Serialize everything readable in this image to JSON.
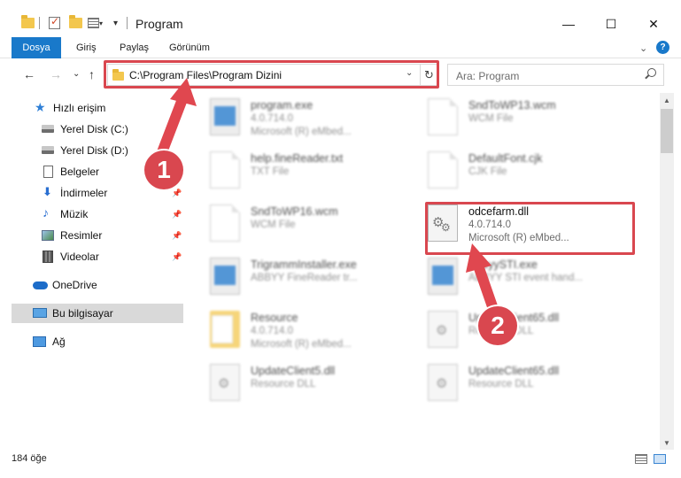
{
  "window": {
    "title": "Program",
    "minimize": "—",
    "maximize": "☐",
    "close": "✕"
  },
  "ribbon": {
    "file_tab": "Dosya",
    "tabs": [
      "Giriş",
      "Paylaş",
      "Görünüm"
    ],
    "help": "?",
    "expand": "⌄"
  },
  "nav": {
    "back": "←",
    "forward": "→",
    "recent": "⌄",
    "up": "↑",
    "address": "C:\\Program Files\\Program Dizini",
    "address_drop": "⌄",
    "refresh": "↻",
    "search_placeholder": "Ara: Program"
  },
  "sidebar": {
    "items": [
      {
        "label": "Hızlı erişim",
        "icon": "star-icon"
      },
      {
        "label": "Yerel Disk (C:)",
        "icon": "drive-icon"
      },
      {
        "label": "Yerel Disk (D:)",
        "icon": "drive-icon"
      },
      {
        "label": "Belgeler",
        "icon": "documents-icon"
      },
      {
        "label": "İndirmeler",
        "icon": "download-icon"
      },
      {
        "label": "Müzik",
        "icon": "music-icon"
      },
      {
        "label": "Resimler",
        "icon": "pictures-icon"
      },
      {
        "label": "Videolar",
        "icon": "videos-icon"
      },
      {
        "label": "OneDrive",
        "icon": "cloud-icon"
      },
      {
        "label": "Bu bilgisayar",
        "icon": "computer-icon"
      },
      {
        "label": "Ağ",
        "icon": "network-icon"
      }
    ],
    "pin": "📌"
  },
  "files": [
    {
      "name": "program.exe",
      "line2": "4.0.714.0",
      "line3": "Microsoft (R) eMbed...",
      "icon": "exe-icon"
    },
    {
      "name": "SndToWP13.wcm",
      "line2": "WCM File",
      "line3": "",
      "icon": "file-icon"
    },
    {
      "name": "help.fineReader.txt",
      "line2": "TXT File",
      "line3": "",
      "icon": "file-icon"
    },
    {
      "name": "DefaultFont.cjk",
      "line2": "CJK File",
      "line3": "",
      "icon": "file-icon"
    },
    {
      "name": "SndToWP16.wcm",
      "line2": "WCM File",
      "line3": "",
      "icon": "file-icon"
    },
    {
      "name": "odcefarm.dll",
      "line2": "4.0.714.0",
      "line3": "Microsoft (R) eMbed...",
      "icon": "gear-file-icon"
    },
    {
      "name": "TrigrammInstaller.exe",
      "line2": "ABBYY FineReader tr...",
      "line3": "",
      "icon": "exe-icon"
    },
    {
      "name": "AbbyySTI.exe",
      "line2": "ABBYY STI event hand...",
      "line3": "",
      "icon": "exe-icon"
    },
    {
      "name": "Resource",
      "line2": "4.0.714.0",
      "line3": "Microsoft (R) eMbed...",
      "icon": "folder-icon"
    },
    {
      "name": "UpdateClient65.dll",
      "line2": "Resource DLL",
      "line3": "",
      "icon": "gear-file-icon"
    },
    {
      "name": "UpdateClient5.dll",
      "line2": "Resource DLL",
      "line3": "",
      "icon": "gear-file-icon"
    },
    {
      "name": "UpdateClient65.dll",
      "line2": "Resource DLL",
      "line3": "",
      "icon": "gear-file-icon"
    }
  ],
  "status": {
    "count": "184 öğe"
  },
  "annotations": {
    "badge1": "1",
    "badge2": "2"
  },
  "colors": {
    "accent": "#1979ca",
    "highlight": "#d9474f"
  }
}
